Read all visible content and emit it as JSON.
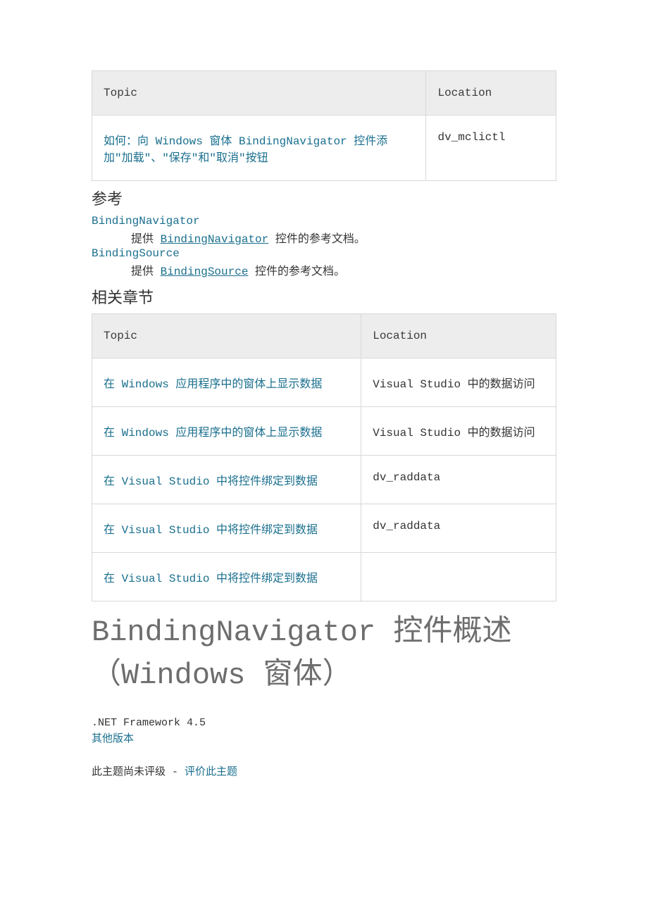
{
  "table1": {
    "headers": [
      "Topic",
      "Location"
    ],
    "rows": [
      {
        "topic": "如何：向 Windows 窗体 BindingNavigator 控件添加\"加载\"、\"保存\"和\"取消\"按钮",
        "location": "dv_mclictl"
      }
    ]
  },
  "reference": {
    "heading": "参考",
    "items": [
      {
        "term": "BindingNavigator",
        "desc_prefix": "提供 ",
        "desc_link": "BindingNavigator",
        "desc_suffix": " 控件的参考文档。"
      },
      {
        "term": "BindingSource",
        "desc_prefix": "提供 ",
        "desc_link": "BindingSource",
        "desc_suffix": " 控件的参考文档。"
      }
    ]
  },
  "related": {
    "heading": "相关章节"
  },
  "table2": {
    "headers": [
      "Topic",
      "Location"
    ],
    "rows": [
      {
        "topic": "在 Windows 应用程序中的窗体上显示数据",
        "location": "Visual Studio 中的数据访问"
      },
      {
        "topic": "在 Windows 应用程序中的窗体上显示数据",
        "location": "Visual Studio 中的数据访问"
      },
      {
        "topic": "在 Visual Studio 中将控件绑定到数据",
        "location": "dv_raddata"
      },
      {
        "topic": "在 Visual Studio 中将控件绑定到数据",
        "location": "dv_raddata"
      },
      {
        "topic": "在 Visual Studio 中将控件绑定到数据",
        "location": ""
      }
    ]
  },
  "article": {
    "title": "BindingNavigator 控件概述（Windows 窗体）",
    "framework": ".NET Framework 4.5",
    "other_versions": "其他版本",
    "rating_text": "此主题尚未评级",
    "rating_sep": " - ",
    "rating_action": "评价此主题"
  }
}
